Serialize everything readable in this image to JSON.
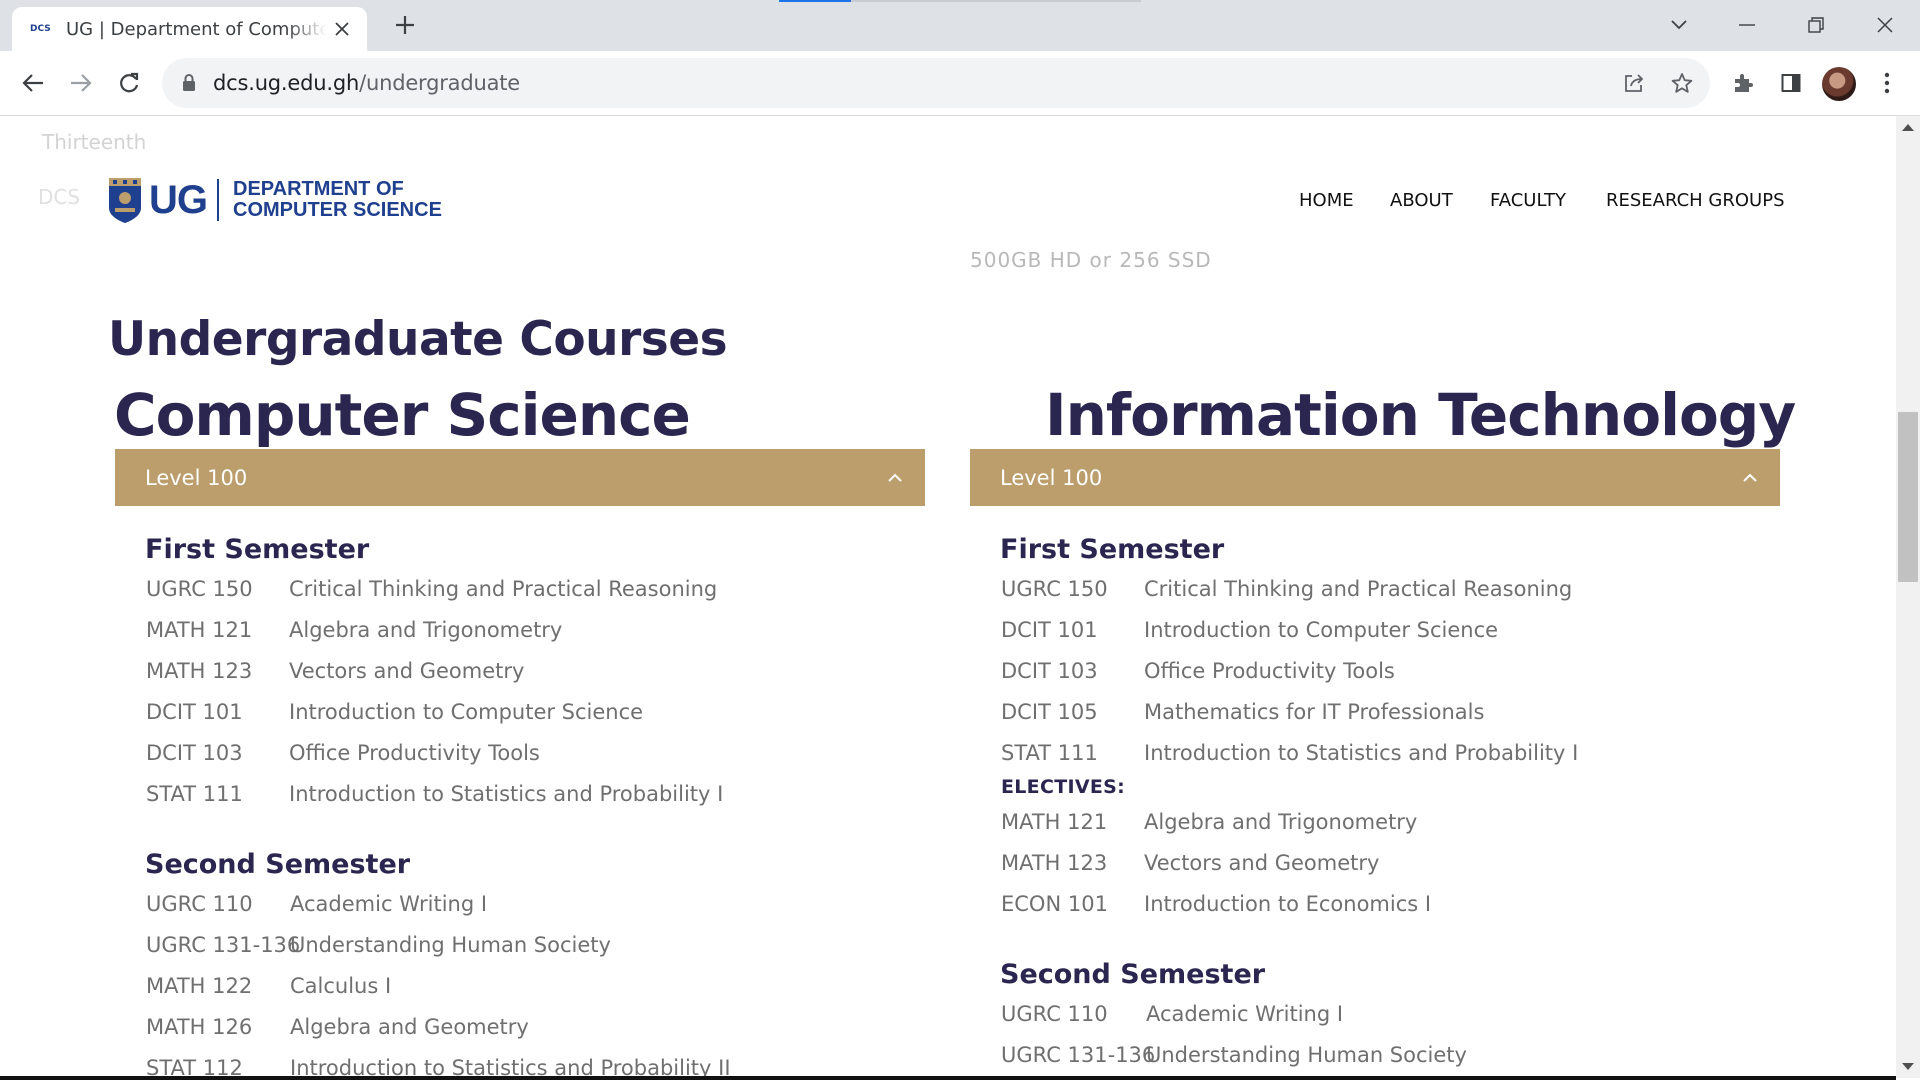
{
  "browser": {
    "tab_title": "UG | Department of Computer Science",
    "favicon_text": "DCS",
    "url_host": "dcs.ug.edu.gh",
    "url_path": "/undergraduate"
  },
  "ghost_text": {
    "line1": "Thirteenth",
    "line2": "DCS",
    "line3": "500GB HD or 256 SSD"
  },
  "header": {
    "logo_ug": "UG",
    "logo_line1": "DEPARTMENT OF",
    "logo_line2": "COMPUTER SCIENCE",
    "nav": [
      "HOME",
      "ABOUT",
      "FACULTY",
      "RESEARCH GROUPS"
    ]
  },
  "page_title": "Undergraduate Courses",
  "cs": {
    "title": "Computer Science",
    "level": "Level 100",
    "first_semester": "First Semester",
    "first_courses": [
      {
        "code": "UGRC 150",
        "name": "Critical Thinking and Practical Reasoning"
      },
      {
        "code": "MATH 121",
        "name": "Algebra and Trigonometry"
      },
      {
        "code": "MATH 123",
        "name": "Vectors and Geometry"
      },
      {
        "code": "DCIT 101",
        "name": "Introduction to Computer Science"
      },
      {
        "code": "DCIT 103",
        "name": "Office Productivity Tools"
      },
      {
        "code": "STAT 111",
        "name": "Introduction to Statistics and Probability I"
      }
    ],
    "second_semester": "Second Semester",
    "second_courses": [
      {
        "code": "UGRC 110",
        "name": "Academic Writing I"
      },
      {
        "code": "UGRC 131-136",
        "name": "Understanding Human Society"
      },
      {
        "code": "MATH 122",
        "name": "Calculus I"
      },
      {
        "code": "MATH 126",
        "name": "Algebra and Geometry"
      },
      {
        "code": "STAT 112",
        "name": "Introduction to Statistics and Probability II"
      }
    ]
  },
  "it": {
    "title": "Information Technology",
    "level": "Level 100",
    "first_semester": "First Semester",
    "first_courses": [
      {
        "code": "UGRC 150",
        "name": "Critical Thinking and Practical Reasoning"
      },
      {
        "code": "DCIT 101",
        "name": "Introduction to Computer Science"
      },
      {
        "code": "DCIT 103",
        "name": "Office Productivity Tools"
      },
      {
        "code": "DCIT 105",
        "name": "Mathematics for IT Professionals"
      },
      {
        "code": "STAT 111",
        "name": "Introduction to Statistics and Probability I"
      }
    ],
    "electives_label": "ELECTIVES:",
    "electives": [
      {
        "code": "MATH 121",
        "name": "Algebra and Trigonometry"
      },
      {
        "code": "MATH 123",
        "name": "Vectors and Geometry"
      },
      {
        "code": "ECON 101",
        "name": "Introduction to Economics I"
      }
    ],
    "second_semester": "Second Semester",
    "second_courses": [
      {
        "code": "UGRC 110",
        "name": "Academic Writing I"
      },
      {
        "code": "UGRC 131-136",
        "name": "Understanding Human Society"
      }
    ]
  },
  "colors": {
    "accordion": "#bc9d6c",
    "heading": "#2b2650",
    "brand": "#1f3f8f",
    "course_text": "#6f6f6f"
  },
  "icons": [
    "back-arrow-icon",
    "forward-arrow-icon",
    "reload-icon",
    "lock-icon",
    "share-icon",
    "star-icon",
    "extensions-icon",
    "side-panel-icon",
    "menu-icon",
    "chevron-up-icon",
    "close-icon",
    "plus-icon"
  ]
}
